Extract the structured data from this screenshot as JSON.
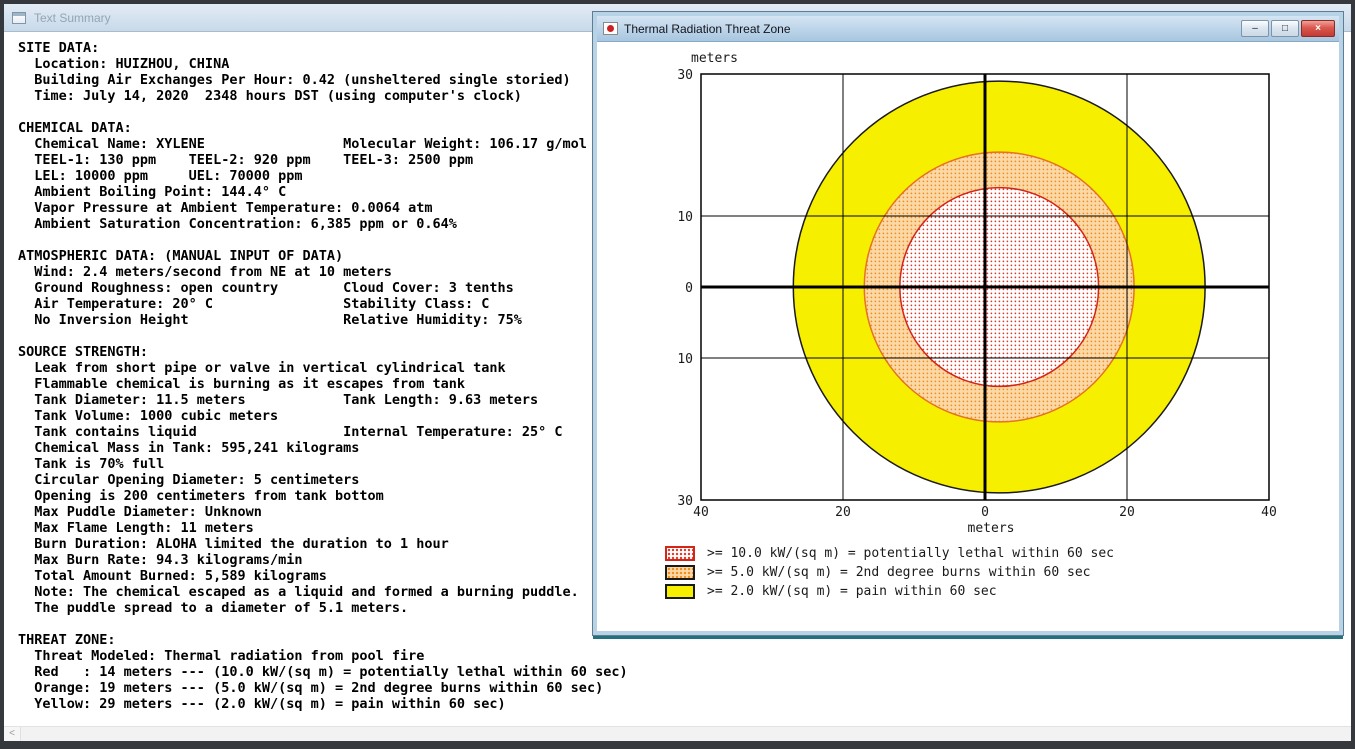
{
  "app": {
    "titlebar": {
      "title": "Text Summary"
    },
    "scrollbar": {
      "left_glyph": "<"
    }
  },
  "text_summary": {
    "lines": [
      "SITE DATA:",
      "  Location: HUIZHOU, CHINA",
      "  Building Air Exchanges Per Hour: 0.42 (unsheltered single storied)",
      "  Time: July 14, 2020  2348 hours DST (using computer's clock)",
      "",
      "CHEMICAL DATA:",
      "  Chemical Name: XYLENE                 Molecular Weight: 106.17 g/mol",
      "  TEEL-1: 130 ppm    TEEL-2: 920 ppm    TEEL-3: 2500 ppm",
      "  LEL: 10000 ppm     UEL: 70000 ppm",
      "  Ambient Boiling Point: 144.4° C",
      "  Vapor Pressure at Ambient Temperature: 0.0064 atm",
      "  Ambient Saturation Concentration: 6,385 ppm or 0.64%",
      "",
      "ATMOSPHERIC DATA: (MANUAL INPUT OF DATA)",
      "  Wind: 2.4 meters/second from NE at 10 meters",
      "  Ground Roughness: open country        Cloud Cover: 3 tenths",
      "  Air Temperature: 20° C                Stability Class: C",
      "  No Inversion Height                   Relative Humidity: 75%",
      "",
      "SOURCE STRENGTH:",
      "  Leak from short pipe or valve in vertical cylindrical tank",
      "  Flammable chemical is burning as it escapes from tank",
      "  Tank Diameter: 11.5 meters            Tank Length: 9.63 meters",
      "  Tank Volume: 1000 cubic meters",
      "  Tank contains liquid                  Internal Temperature: 25° C",
      "  Chemical Mass in Tank: 595,241 kilograms",
      "  Tank is 70% full",
      "  Circular Opening Diameter: 5 centimeters",
      "  Opening is 200 centimeters from tank bottom",
      "  Max Puddle Diameter: Unknown",
      "  Max Flame Length: 11 meters",
      "  Burn Duration: ALOHA limited the duration to 1 hour",
      "  Max Burn Rate: 94.3 kilograms/min",
      "  Total Amount Burned: 5,589 kilograms",
      "  Note: The chemical escaped as a liquid and formed a burning puddle.",
      "  The puddle spread to a diameter of 5.1 meters.",
      "",
      "THREAT ZONE:",
      "  Threat Modeled: Thermal radiation from pool fire",
      "  Red   : 14 meters --- (10.0 kW/(sq m) = potentially lethal within 60 sec)",
      "  Orange: 19 meters --- (5.0 kW/(sq m) = 2nd degree burns within 60 sec)",
      "  Yellow: 29 meters --- (2.0 kW/(sq m) = pain within 60 sec)"
    ]
  },
  "threat_zone_window": {
    "title": "Thermal Radiation Threat Zone",
    "controls": {
      "minimize": "–",
      "maximize": "□",
      "close": "×"
    }
  },
  "chart_data": {
    "type": "area",
    "subtype": "threat-zone-rings",
    "title": "Thermal Radiation Threat Zone",
    "xlabel": "meters",
    "ylabel": "meters",
    "xlim": [
      -40,
      40
    ],
    "ylim": [
      -30,
      30
    ],
    "grid": true,
    "x_ticks": [
      {
        "value": -40,
        "label": "40"
      },
      {
        "value": -20,
        "label": "20"
      },
      {
        "value": 0,
        "label": "0"
      },
      {
        "value": 20,
        "label": "20"
      },
      {
        "value": 40,
        "label": "40"
      }
    ],
    "y_ticks": [
      {
        "value": 30,
        "label": "30"
      },
      {
        "value": 10,
        "label": "10"
      },
      {
        "value": 0,
        "label": "0"
      },
      {
        "value": -10,
        "label": "10"
      },
      {
        "value": -30,
        "label": "30"
      }
    ],
    "grid_x_values": [
      -20,
      20
    ],
    "grid_y_values": [
      10,
      -10
    ],
    "crosshair_center": [
      0,
      0
    ],
    "center_offset_m": [
      2,
      0
    ],
    "zones": [
      {
        "name": "red",
        "radius_m": 14,
        "threshold": ">= 10.0 kW/(sq m)",
        "label": ">= 10.0 kW/(sq m) = potentially lethal within 60 sec",
        "swatch": "red-dots",
        "outline": "#d22618",
        "dot_color": "#e03425",
        "fill_bg": "#ffffff",
        "legend_border": "#d22618"
      },
      {
        "name": "orange",
        "radius_m": 19,
        "threshold": ">= 5.0 kW/(sq m)",
        "label": ">= 5.0 kW/(sq m) = 2nd degree burns within 60 sec",
        "swatch": "orange-dots",
        "outline": "#e5731f",
        "dot_color": "#ef8b1f",
        "fill_bg": "#fbd9a6",
        "legend_border": "#1a1a1a"
      },
      {
        "name": "yellow",
        "radius_m": 29,
        "threshold": ">= 2.0 kW/(sq m)",
        "label": ">= 2.0 kW/(sq m) = pain within 60 sec",
        "swatch": "solid-yellow",
        "outline": "#1a1a1a",
        "fill": "#f7ef00",
        "legend_border": "#1a1a1a"
      }
    ],
    "legend_position": "bottom-left"
  }
}
